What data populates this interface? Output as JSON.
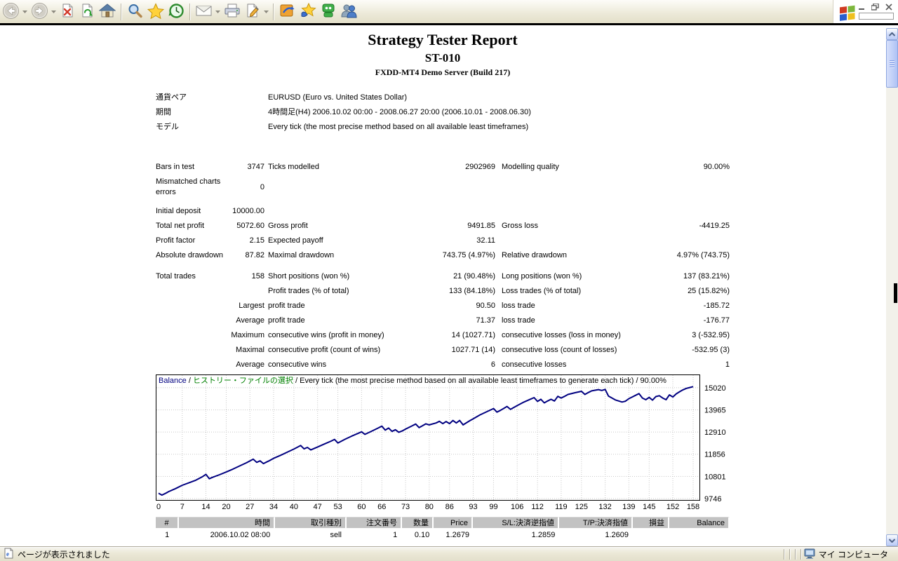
{
  "browser": {
    "toolbar": {
      "icons": [
        "back",
        "forward",
        "stop",
        "refresh",
        "home",
        "search",
        "favorites",
        "history",
        "mail",
        "print",
        "edit",
        "msn",
        "netmeeting",
        "messenger",
        "contacts"
      ]
    },
    "window_controls": [
      "minimize",
      "restore",
      "close"
    ],
    "status": {
      "left": "ページが表示されました",
      "zone": "マイ コンピュータ"
    }
  },
  "report": {
    "title": "Strategy Tester Report",
    "subtitle": "ST-010",
    "server": "FXDD-MT4 Demo Server (Build 217)",
    "params": [
      {
        "label": "通貨ペア",
        "value": "EURUSD (Euro vs. United States Dollar)"
      },
      {
        "label": "期間",
        "value": "4時間足(H4) 2006.10.02 00:00 - 2008.06.27 20:00 (2006.10.01 - 2008.06.30)"
      },
      {
        "label": "モデル",
        "value": "Every tick (the most precise method based on all available least timeframes)"
      }
    ],
    "stats_groups": [
      [
        [
          [
            "Bars in test",
            "3747"
          ],
          [
            "Ticks modelled",
            "2902969"
          ],
          [
            "Modelling quality",
            "90.00%"
          ]
        ],
        [
          [
            "Mismatched charts errors",
            "0"
          ],
          [
            "",
            ""
          ],
          [
            "",
            ""
          ]
        ]
      ],
      [
        [
          [
            "Initial deposit",
            "10000.00"
          ],
          [
            "",
            ""
          ],
          [
            "",
            ""
          ]
        ],
        [
          [
            "Total net profit",
            "5072.60"
          ],
          [
            "Gross profit",
            "9491.85"
          ],
          [
            "Gross loss",
            "-4419.25"
          ]
        ],
        [
          [
            "Profit factor",
            "2.15"
          ],
          [
            "Expected payoff",
            "32.11"
          ],
          [
            "",
            ""
          ]
        ],
        [
          [
            "Absolute drawdown",
            "87.82"
          ],
          [
            "Maximal drawdown",
            "743.75 (4.97%)"
          ],
          [
            "Relative drawdown",
            "4.97% (743.75)"
          ]
        ]
      ],
      [
        [
          [
            "Total trades",
            "158"
          ],
          [
            "Short positions (won %)",
            "21 (90.48%)"
          ],
          [
            "Long positions (won %)",
            "137 (83.21%)"
          ]
        ],
        [
          [
            "",
            ""
          ],
          [
            "Profit trades (% of total)",
            "133 (84.18%)"
          ],
          [
            "Loss trades (% of total)",
            "25 (15.82%)"
          ]
        ],
        [
          [
            "",
            "Largest"
          ],
          [
            "profit trade",
            "90.50"
          ],
          [
            "loss trade",
            "-185.72"
          ]
        ],
        [
          [
            "",
            "Average"
          ],
          [
            "profit trade",
            "71.37"
          ],
          [
            "loss trade",
            "-176.77"
          ]
        ],
        [
          [
            "",
            "Maximum"
          ],
          [
            "consecutive wins (profit in money)",
            "14 (1027.71)"
          ],
          [
            "consecutive losses (loss in money)",
            "3 (-532.95)"
          ]
        ],
        [
          [
            "",
            "Maximal"
          ],
          [
            "consecutive profit (count of wins)",
            "1027.71 (14)"
          ],
          [
            "consecutive loss (count of losses)",
            "-532.95 (3)"
          ]
        ],
        [
          [
            "",
            "Average"
          ],
          [
            "consecutive wins",
            "6"
          ],
          [
            "consecutive losses",
            "1"
          ]
        ]
      ]
    ]
  },
  "chart_data": {
    "type": "line",
    "title_parts": [
      {
        "text": "Balance",
        "color": "#000080"
      },
      {
        "text": " / ",
        "color": "#000000"
      },
      {
        "text": "ヒストリー・ファイルの選択",
        "color": "#008000"
      },
      {
        "text": " / Every tick (the most precise method based on all available least timeframes to generate each tick) / 90.00%",
        "color": "#000000"
      }
    ],
    "x_ticks": [
      0,
      7,
      14,
      20,
      27,
      34,
      40,
      47,
      53,
      60,
      66,
      73,
      80,
      86,
      93,
      99,
      106,
      112,
      119,
      125,
      132,
      139,
      145,
      152,
      158
    ],
    "y_ticks": [
      15020,
      13965,
      12910,
      11856,
      10801,
      9746
    ],
    "xlim": [
      0,
      158
    ],
    "ylim": [
      9645,
      15650
    ],
    "grid": true,
    "series": [
      {
        "name": "Balance",
        "color": "#000080",
        "points": [
          [
            0,
            10000
          ],
          [
            1,
            9912
          ],
          [
            2,
            9990
          ],
          [
            3,
            10080
          ],
          [
            5,
            10220
          ],
          [
            7,
            10380
          ],
          [
            9,
            10500
          ],
          [
            11,
            10620
          ],
          [
            13,
            10790
          ],
          [
            14,
            10900
          ],
          [
            15,
            10690
          ],
          [
            16,
            10760
          ],
          [
            18,
            10880
          ],
          [
            20,
            11010
          ],
          [
            22,
            11150
          ],
          [
            24,
            11300
          ],
          [
            26,
            11450
          ],
          [
            28,
            11620
          ],
          [
            29,
            11470
          ],
          [
            30,
            11540
          ],
          [
            31,
            11410
          ],
          [
            32,
            11490
          ],
          [
            33,
            11570
          ],
          [
            34,
            11660
          ],
          [
            36,
            11800
          ],
          [
            38,
            11950
          ],
          [
            40,
            12100
          ],
          [
            42,
            12270
          ],
          [
            43,
            12110
          ],
          [
            44,
            12180
          ],
          [
            45,
            12060
          ],
          [
            47,
            12200
          ],
          [
            49,
            12340
          ],
          [
            51,
            12480
          ],
          [
            52,
            12560
          ],
          [
            53,
            12390
          ],
          [
            55,
            12560
          ],
          [
            57,
            12710
          ],
          [
            59,
            12850
          ],
          [
            60,
            12920
          ],
          [
            61,
            12800
          ],
          [
            63,
            12950
          ],
          [
            65,
            13110
          ],
          [
            66,
            13190
          ],
          [
            67,
            13000
          ],
          [
            68,
            13100
          ],
          [
            69,
            12940
          ],
          [
            70,
            13020
          ],
          [
            71,
            12900
          ],
          [
            72,
            12960
          ],
          [
            73,
            13050
          ],
          [
            75,
            13210
          ],
          [
            76,
            13290
          ],
          [
            77,
            13120
          ],
          [
            78,
            13210
          ],
          [
            79,
            13300
          ],
          [
            80,
            13250
          ],
          [
            82,
            13340
          ],
          [
            83,
            13420
          ],
          [
            84,
            13310
          ],
          [
            85,
            13410
          ],
          [
            86,
            13310
          ],
          [
            87,
            13460
          ],
          [
            88,
            13340
          ],
          [
            89,
            13460
          ],
          [
            90,
            13250
          ],
          [
            92,
            13450
          ],
          [
            93,
            13540
          ],
          [
            95,
            13730
          ],
          [
            97,
            13880
          ],
          [
            99,
            14030
          ],
          [
            100,
            13860
          ],
          [
            101,
            13940
          ],
          [
            103,
            14130
          ],
          [
            104,
            13990
          ],
          [
            106,
            14170
          ],
          [
            108,
            14340
          ],
          [
            110,
            14480
          ],
          [
            111,
            14550
          ],
          [
            112,
            14370
          ],
          [
            113,
            14470
          ],
          [
            114,
            14300
          ],
          [
            115,
            14390
          ],
          [
            116,
            14470
          ],
          [
            117,
            14390
          ],
          [
            118,
            14610
          ],
          [
            119,
            14530
          ],
          [
            120,
            14610
          ],
          [
            121,
            14700
          ],
          [
            123,
            14780
          ],
          [
            125,
            14850
          ],
          [
            126,
            14700
          ],
          [
            127,
            14790
          ],
          [
            128,
            14870
          ],
          [
            130,
            14930
          ],
          [
            131,
            14890
          ],
          [
            132,
            14940
          ],
          [
            133,
            14620
          ],
          [
            135,
            14440
          ],
          [
            137,
            14340
          ],
          [
            138,
            14380
          ],
          [
            139,
            14500
          ],
          [
            140,
            14580
          ],
          [
            141,
            14660
          ],
          [
            142,
            14740
          ],
          [
            143,
            14530
          ],
          [
            144,
            14450
          ],
          [
            145,
            14560
          ],
          [
            146,
            14430
          ],
          [
            147,
            14600
          ],
          [
            148,
            14640
          ],
          [
            149,
            14530
          ],
          [
            150,
            14450
          ],
          [
            151,
            14680
          ],
          [
            152,
            14580
          ],
          [
            153,
            14730
          ],
          [
            154,
            14830
          ],
          [
            155,
            14920
          ],
          [
            156,
            14990
          ],
          [
            157,
            15030
          ],
          [
            158,
            15072.6
          ]
        ]
      }
    ]
  },
  "trades_table": {
    "headers": [
      "#",
      "時間",
      "取引種別",
      "注文番号",
      "数量",
      "Price",
      "S/L:決済逆指値",
      "T/P:決済指値",
      "損益",
      "Balance"
    ],
    "rows": [
      [
        "1",
        "2006.10.02 08:00",
        "sell",
        "1",
        "0.10",
        "1.2679",
        "1.2859",
        "1.2609",
        "",
        ""
      ]
    ]
  }
}
